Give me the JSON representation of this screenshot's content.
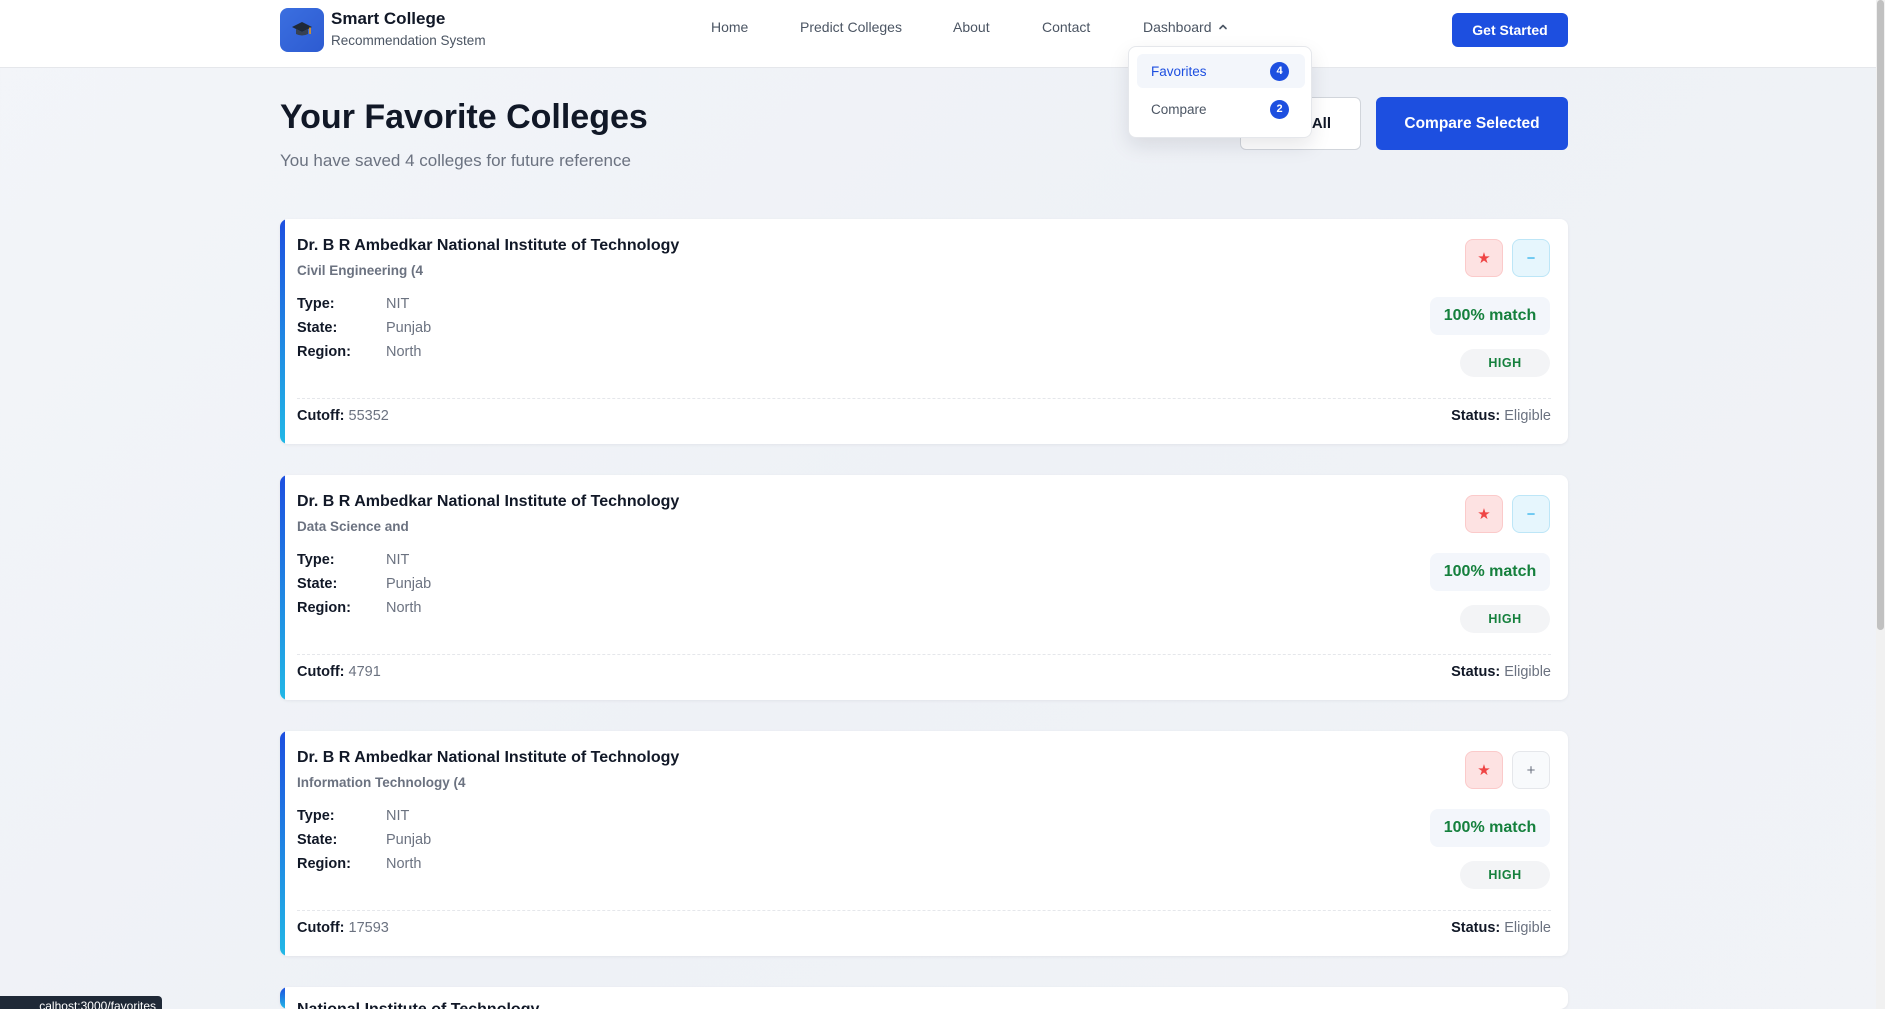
{
  "brand": {
    "title": "Smart College",
    "subtitle": "Recommendation System"
  },
  "nav": {
    "home": "Home",
    "predict": "Predict Colleges",
    "about": "About",
    "contact": "Contact",
    "dashboard": "Dashboard",
    "get_started": "Get Started"
  },
  "dropdown": {
    "items": [
      {
        "label": "Favorites",
        "count": "4"
      },
      {
        "label": "Compare",
        "count": "2"
      }
    ]
  },
  "page": {
    "title": "Your Favorite Colleges",
    "subtitle": "You have saved 4 colleges for future reference",
    "clear_all_label": "All",
    "compare_selected_label": "Compare Selected"
  },
  "labels": {
    "type": "Type:",
    "state": "State:",
    "region": "Region:",
    "cutoff": "Cutoff:",
    "status": "Status:"
  },
  "colleges": [
    {
      "name": "Dr. B R Ambedkar National Institute of Technology",
      "branch": "Civil Engineering (4",
      "type": "NIT",
      "state": "Punjab",
      "region": "North",
      "match": "100% match",
      "level": "HIGH",
      "cutoff": "55352",
      "status": "Eligible",
      "fav_icon": "★",
      "compare_icon": "−"
    },
    {
      "name": "Dr. B R Ambedkar National Institute of Technology",
      "branch": "Data Science and",
      "type": "NIT",
      "state": "Punjab",
      "region": "North",
      "match": "100% match",
      "level": "HIGH",
      "cutoff": "4791",
      "status": "Eligible",
      "fav_icon": "★",
      "compare_icon": "−"
    },
    {
      "name": "Dr. B R Ambedkar National Institute of Technology",
      "branch": "Information Technology (4",
      "type": "NIT",
      "state": "Punjab",
      "region": "North",
      "match": "100% match",
      "level": "HIGH",
      "cutoff": "17593",
      "status": "Eligible",
      "fav_icon": "★",
      "compare_icon": "+"
    },
    {
      "name": "National Institute of Technology"
    }
  ],
  "status_bar": {
    "url": "calhost:3000/favorites"
  },
  "colors": {
    "primary": "#1d4fe0",
    "accent_cyan": "#22b8e6",
    "match_green": "#15803d",
    "favorite_red": "#ef4444"
  }
}
